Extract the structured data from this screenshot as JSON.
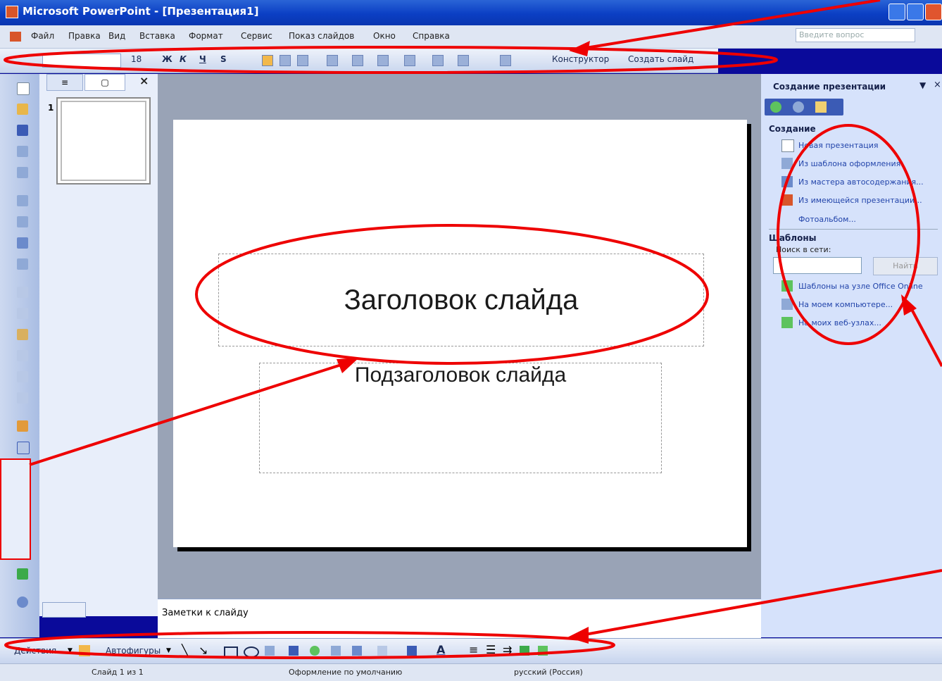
{
  "window": {
    "title": "Microsoft PowerPoint - [Презентация1]"
  },
  "menu": [
    "Файл",
    "Правка",
    "Вид",
    "Вставка",
    "Формат",
    "Сервис",
    "Показ слайдов",
    "Окно",
    "Справка"
  ],
  "help_placeholder": "Введите вопрос",
  "format_toolbar": {
    "font_size": "18",
    "bold": "Ж",
    "italic": "К",
    "underline": "Ч",
    "shadow": "S",
    "designer": "Конструктор",
    "new_slide": "Создать слайд"
  },
  "slides_pane": {
    "slide_number": "1",
    "close": "×"
  },
  "slide": {
    "title": "Заголовок слайда",
    "subtitle": "Подзаголовок слайда"
  },
  "notes": "Заметки к слайду",
  "task_pane": {
    "title": "Создание презентации",
    "section_create": "Создание",
    "create_links": [
      "Новая презентация",
      "Из шаблона оформления",
      "Из мастера автосодержания...",
      "Из имеющейся презентации...",
      "Фотоальбом..."
    ],
    "section_templates": "Шаблоны",
    "search_label": "Поиск в сети:",
    "find_button": "Найти",
    "template_links": [
      "Шаблоны на узле Office Online",
      "На моем компьютере...",
      "На моих веб-узлах..."
    ]
  },
  "drawing_toolbar": {
    "actions": "Действия",
    "autoshapes": "Автофигуры"
  },
  "status": {
    "slide": "Слайд 1 из 1",
    "design": "Оформление по умолчанию",
    "language": "русский (Россия)"
  },
  "colors": {
    "annotation": "#ee0000",
    "title_bar": "#0b3fc4",
    "background": "#0a0a9a"
  }
}
